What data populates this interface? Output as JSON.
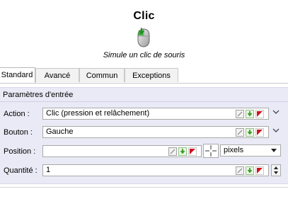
{
  "header": {
    "title": "Clic",
    "subtitle": "Simule un clic de souris",
    "icon": "mouse-click-icon"
  },
  "tabs": [
    {
      "label": "Standard",
      "active": true
    },
    {
      "label": "Avancé",
      "active": false
    },
    {
      "label": "Commun",
      "active": false
    },
    {
      "label": "Exceptions",
      "active": false
    }
  ],
  "panel": {
    "title": "Paramètres d'entrée",
    "fields": {
      "action": {
        "label": "Action :",
        "value": "Clic (pression et relâchement)"
      },
      "button": {
        "label": "Bouton :",
        "value": "Gauche"
      },
      "position": {
        "label": "Position :",
        "value": "",
        "unit": "pixels"
      },
      "quantity": {
        "label": "Quantité :",
        "value": "1"
      }
    }
  },
  "colors": {
    "panel_background": "#eaeaf6",
    "variable_green": "#3d9b2b",
    "marker_red": "#d2121c"
  }
}
